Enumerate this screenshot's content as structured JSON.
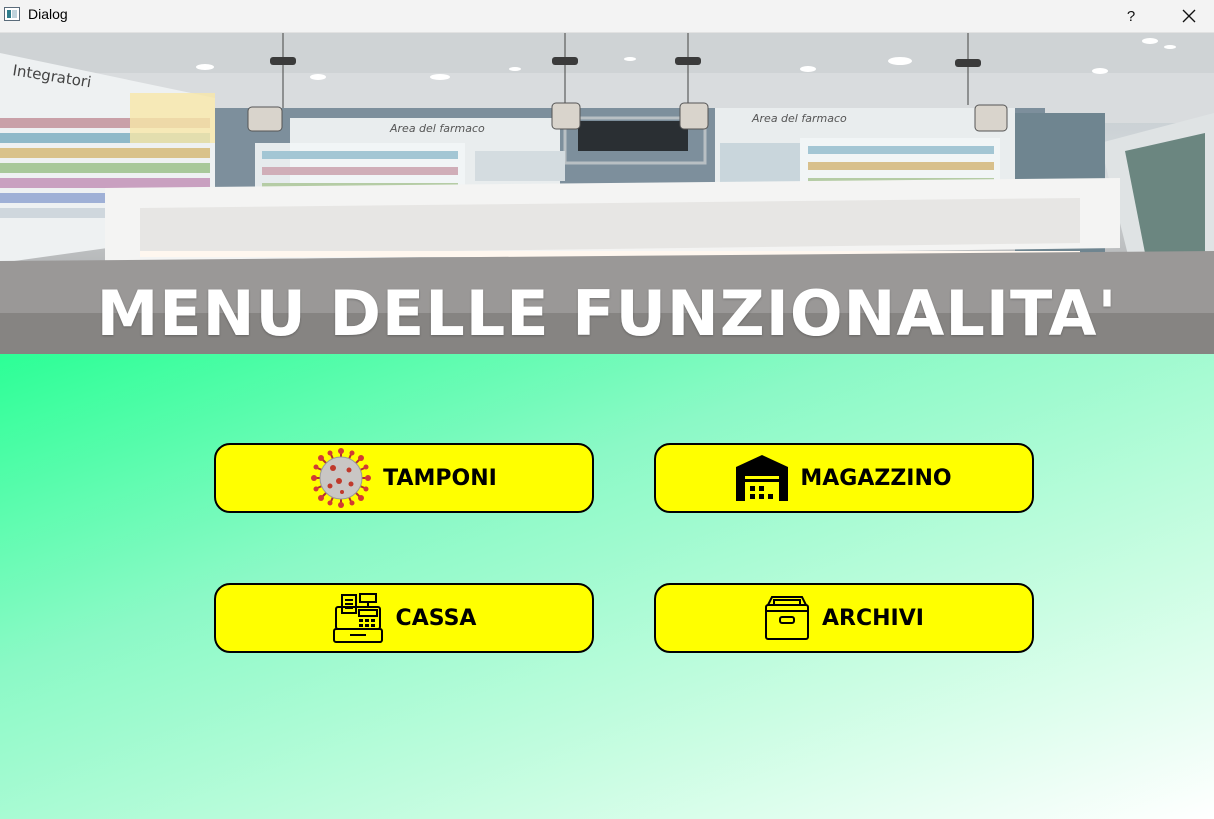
{
  "window": {
    "title": "Dialog",
    "help_label": "?"
  },
  "banner": {
    "title": "MENU DELLE FUNZIONALITA'",
    "sign_left": "Area del farmaco",
    "sign_right": "Area del farmaco",
    "sign_wall": "Integratori"
  },
  "menu": {
    "tamponi": {
      "label": "TAMPONI",
      "icon": "virus-icon"
    },
    "magazzino": {
      "label": "MAGAZZINO",
      "icon": "warehouse-icon"
    },
    "cassa": {
      "label": "CASSA",
      "icon": "cash-register-icon"
    },
    "archivi": {
      "label": "ARCHIVI",
      "icon": "archive-box-icon"
    }
  },
  "colors": {
    "button_bg": "#ffff00",
    "gradient_start": "#2cff96",
    "gradient_end": "#ffffff"
  }
}
